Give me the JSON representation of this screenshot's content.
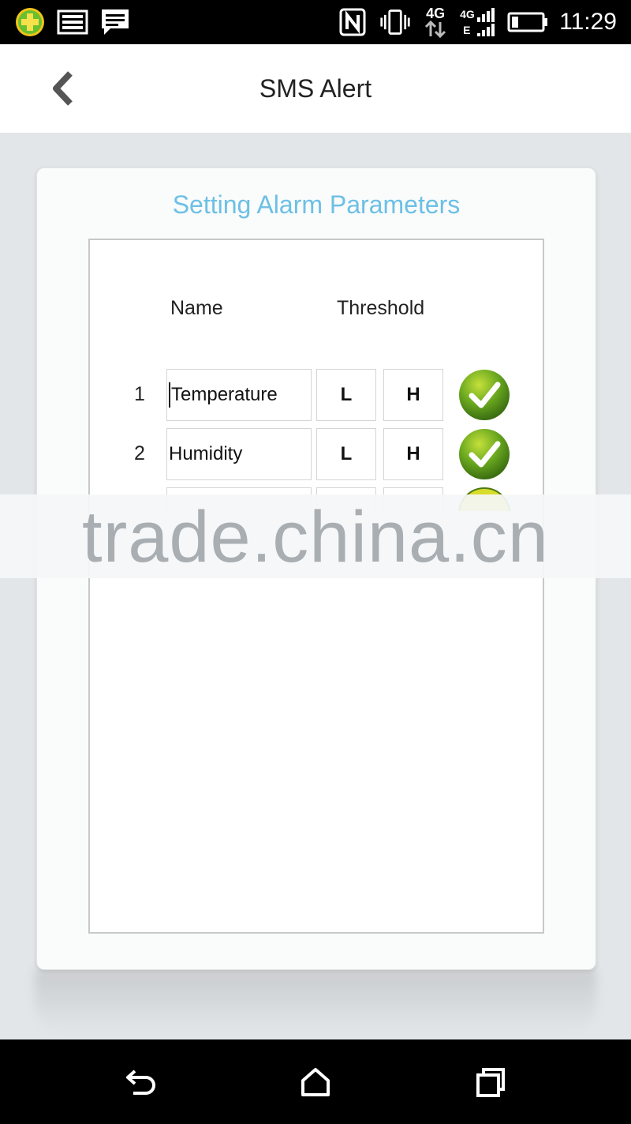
{
  "status_bar": {
    "time": "11:29",
    "left_icons": [
      "medical-cross-app-icon",
      "gallery-notification-icon",
      "message-notification-icon"
    ],
    "right_icons": [
      "nfc-icon",
      "vibrate-icon",
      "4g-data-icon",
      "4g-signal-icon",
      "battery-icon"
    ],
    "network_label": "4G",
    "signal_label": "4G",
    "signal_sub": "E"
  },
  "header": {
    "title": "SMS Alert",
    "back_icon": "chevron-left-icon"
  },
  "card": {
    "title": "Setting Alarm Parameters",
    "title_color": "#6cc0e5",
    "columns": {
      "name": "Name",
      "threshold": "Threshold"
    },
    "rows": [
      {
        "number": "1",
        "name": "Temperature",
        "low": "L",
        "high": "H",
        "enabled": true
      },
      {
        "number": "2",
        "name": "Humidity",
        "low": "L",
        "high": "H",
        "enabled": true
      }
    ]
  },
  "watermark": "trade.china.cn",
  "nav": {
    "back_icon": "back-arrow-icon",
    "home_icon": "home-icon",
    "recents_icon": "recent-apps-icon"
  },
  "colors": {
    "check_green": "#5c9a1f",
    "check_yellow": "#d8dc2a"
  }
}
